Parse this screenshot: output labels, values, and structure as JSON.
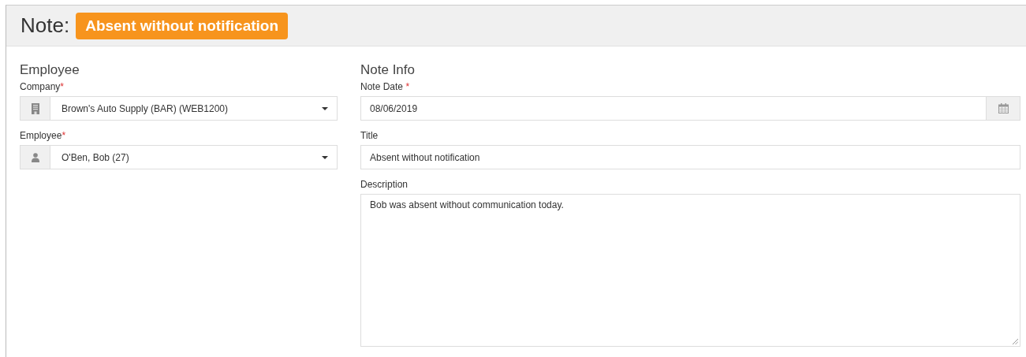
{
  "header": {
    "label": "Note:",
    "badge": "Absent without notification"
  },
  "sections": [
    {
      "heading": "Employee",
      "fields": [
        {
          "kind": "select",
          "label": "Company",
          "required_mark": "*",
          "value": "Brown's Auto Supply (BAR) (WEB1200)"
        },
        {
          "kind": "select",
          "label": "Employee",
          "required_mark": "*",
          "value": "O'Ben, Bob (27)"
        }
      ]
    },
    {
      "heading": "Note Info",
      "fields": [
        {
          "kind": "date",
          "label": "Note Date",
          "required_mark": "*",
          "value": "08/06/2019"
        },
        {
          "kind": "text",
          "label": "Title",
          "value": "Absent without notification"
        },
        {
          "kind": "textarea",
          "label": "Description",
          "value": "Bob was absent without communication today."
        }
      ]
    }
  ]
}
